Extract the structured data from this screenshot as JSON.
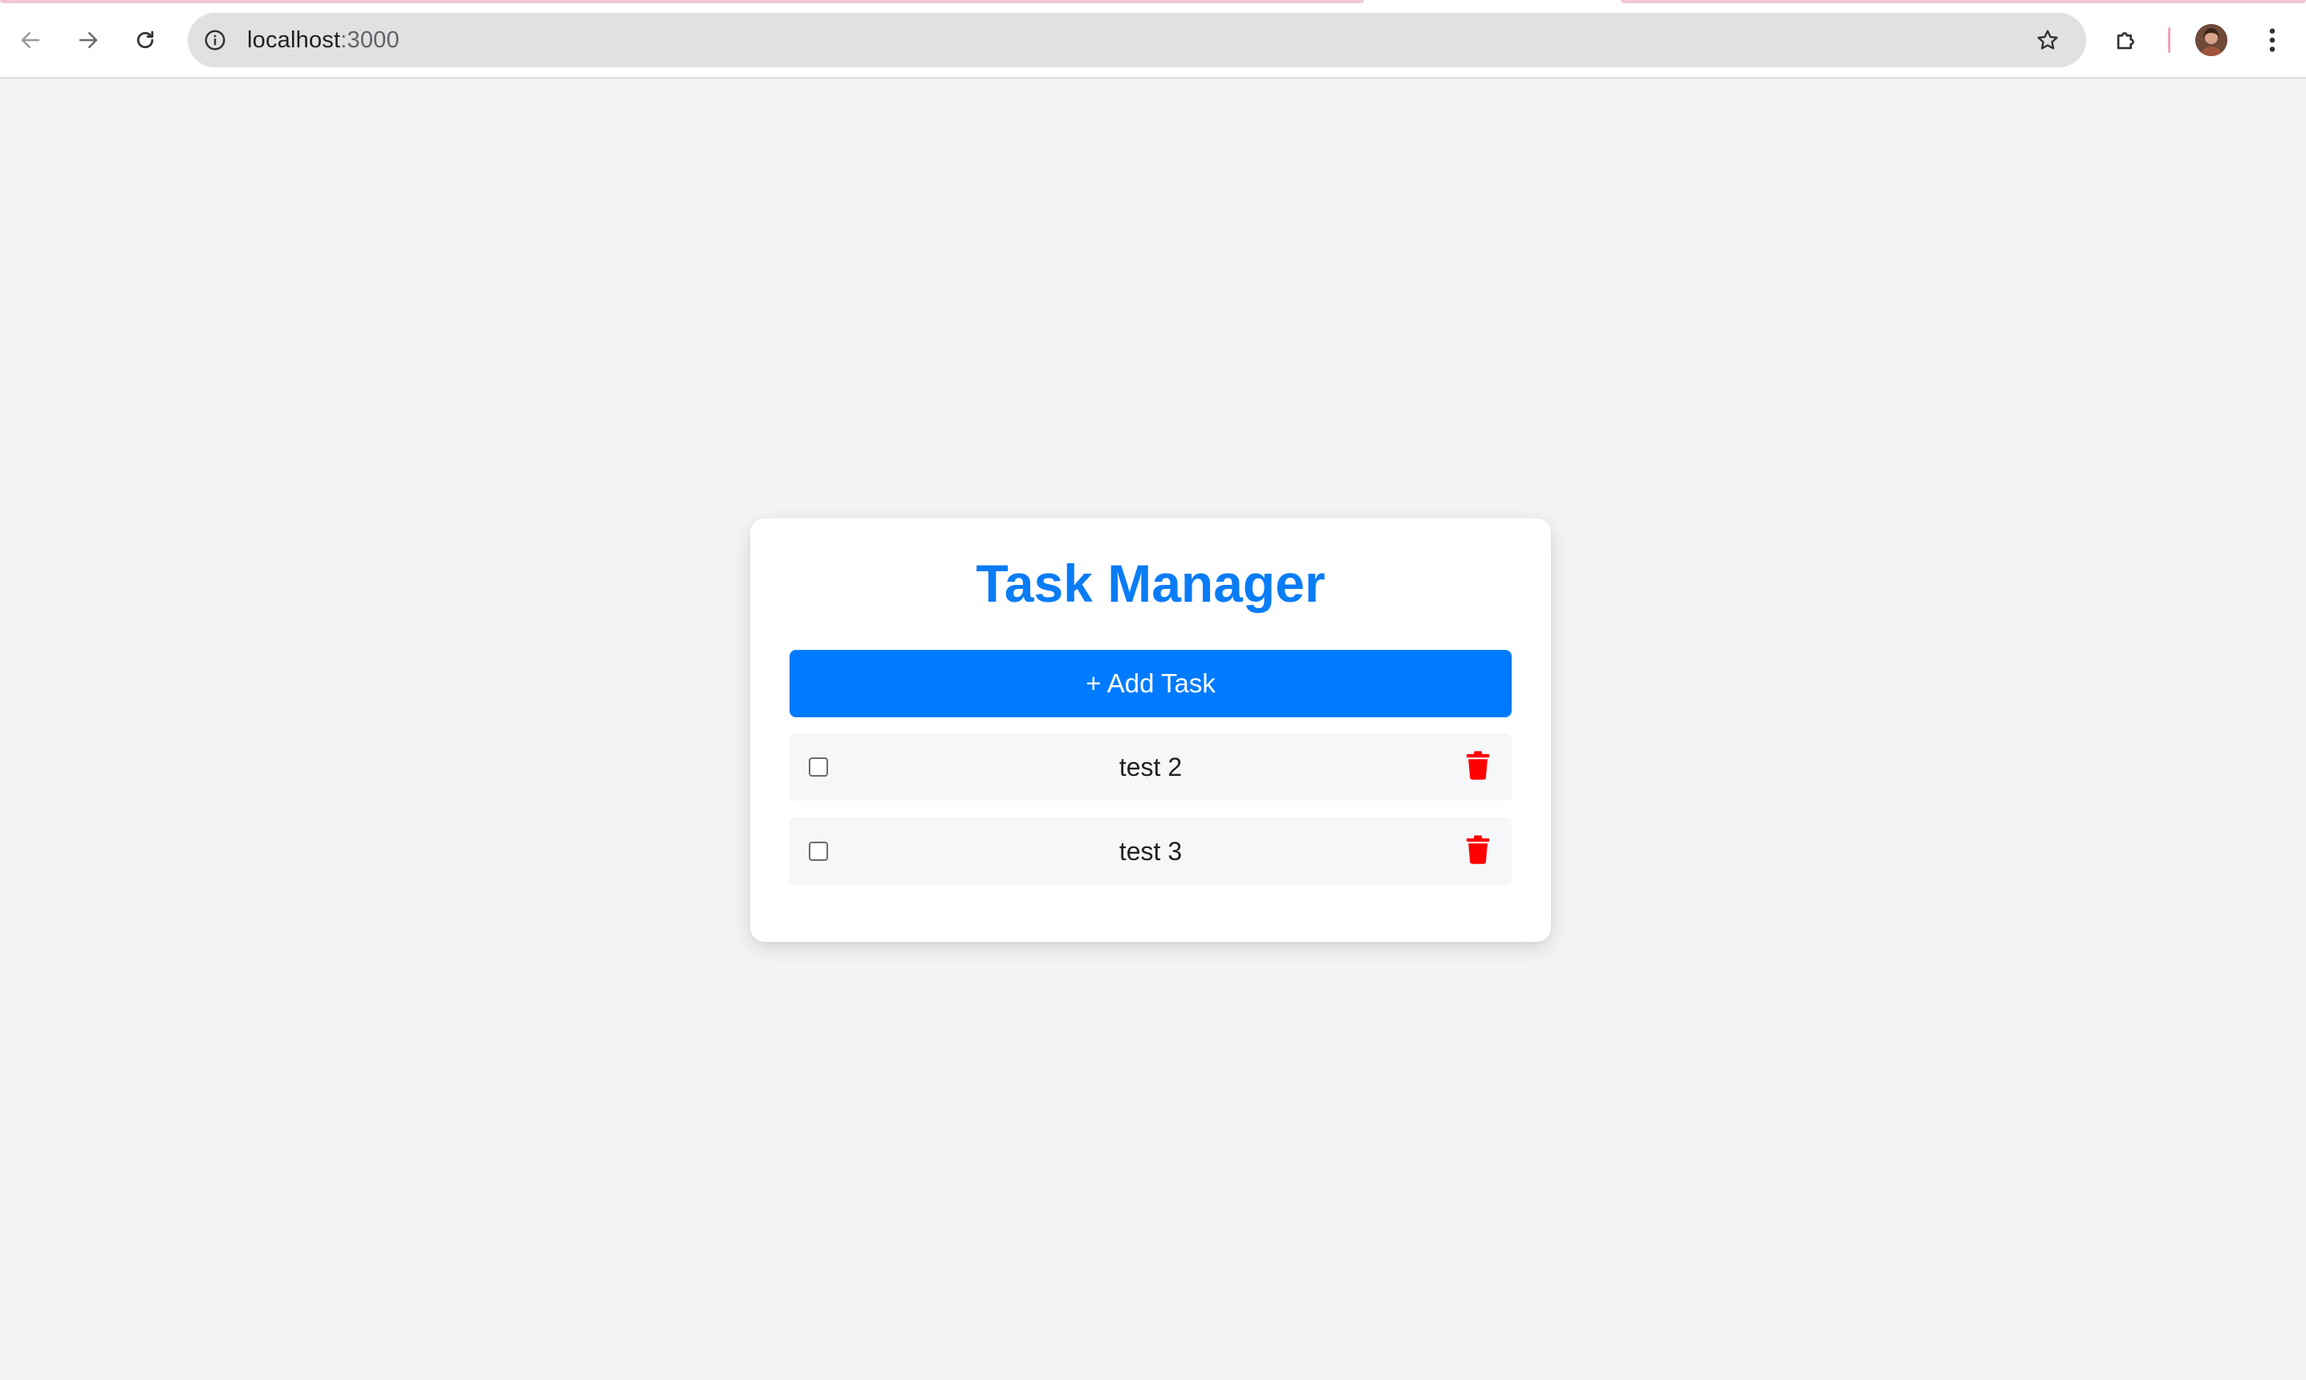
{
  "browser": {
    "url_host": "localhost",
    "url_port": ":3000",
    "icons": {
      "back": "arrow-left-icon",
      "forward": "arrow-right-icon",
      "reload": "reload-icon",
      "site_info": "info-icon",
      "bookmark": "star-icon",
      "extensions": "puzzle-icon",
      "menu": "kebab-menu-icon"
    }
  },
  "app": {
    "title": "Task Manager",
    "add_button_label": "+ Add Task",
    "tasks": [
      {
        "label": "test 2",
        "completed": false
      },
      {
        "label": "test 3",
        "completed": false
      }
    ]
  },
  "colors": {
    "accent": "#007bff",
    "title": "#0a7cf5",
    "delete": "#ff0000",
    "page_background": "#f4f4f4"
  }
}
